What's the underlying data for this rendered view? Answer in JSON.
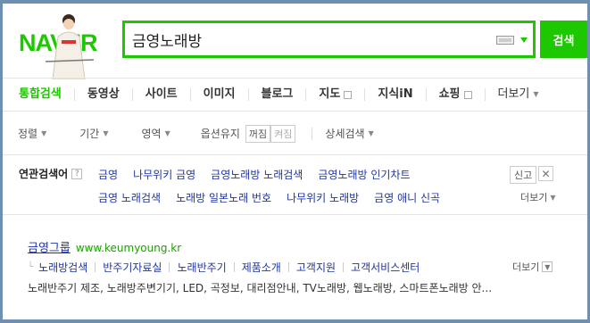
{
  "header": {
    "logo_text": "NAVER",
    "search_value": "금영노래방",
    "search_button": "검색",
    "brand_color": "#1ec800"
  },
  "tabs": [
    {
      "label": "통합검색",
      "active": true
    },
    {
      "label": "동영상"
    },
    {
      "label": "사이트"
    },
    {
      "label": "이미지"
    },
    {
      "label": "블로그"
    },
    {
      "label": "지도",
      "icon": "box-icon"
    },
    {
      "label": "지식iN"
    },
    {
      "label": "쇼핑",
      "icon": "box-icon"
    },
    {
      "label": "더보기",
      "icon": "chevron-down-icon"
    }
  ],
  "filters": {
    "sort": "정렬",
    "period": "기간",
    "area": "영역",
    "option_keep": "옵션유지",
    "off": "꺼짐",
    "on": "켜짐",
    "detail": "상세검색"
  },
  "related": {
    "title": "연관검색어",
    "help": "?",
    "row1": [
      "금영",
      "나무위키 금영",
      "금영노래방 노래검색",
      "금영노래방 인기차트"
    ],
    "row2": [
      "금영 노래검색",
      "노래방 일본노래 번호",
      "나무위키 노래방",
      "금영 애니 신곡"
    ],
    "report": "신고",
    "more": "더보기"
  },
  "result": {
    "title": "금영그룹",
    "url": "www.keumyoung.kr",
    "sitelinks": [
      "노래방검색",
      "반주기자료실",
      "노래반주기",
      "제품소개",
      "고객지원",
      "고객서비스센터"
    ],
    "more": "더보기",
    "description": "노래반주기 제조, 노래방주변기기, LED, 곡정보, 대리점안내, TV노래방, 웹노래방, 스마트폰노래방 안..."
  }
}
